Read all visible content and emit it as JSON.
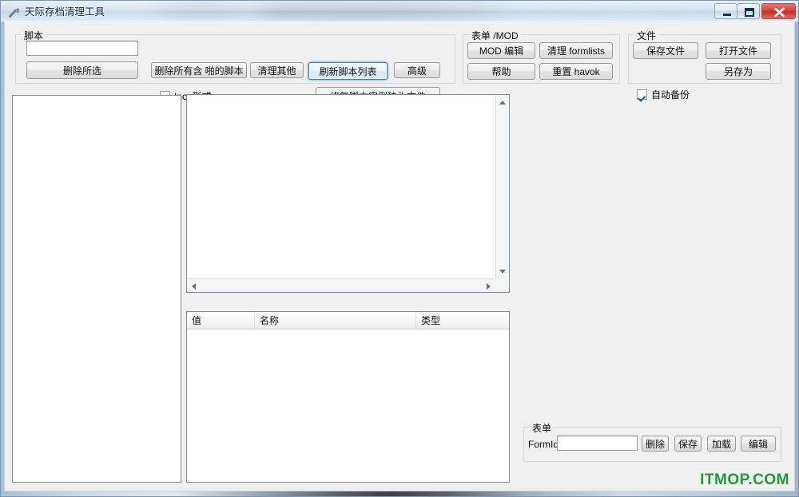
{
  "window": {
    "title": "天际存档清理工具",
    "icon": "wrench-icon",
    "controls": {
      "minimize": "minimize-icon",
      "maximize": "maximize-icon",
      "close": "close-icon"
    }
  },
  "script_group": {
    "legend": "脚本",
    "filter_value": "",
    "filter_placeholder": "",
    "delete_selected": "删除所选",
    "delete_all_containing": "删除所有含 啪的脚本",
    "clean_others": "清理其他",
    "refresh_list": "刷新脚本列表",
    "advanced": "高级",
    "inc_form_label": "Inc. 形式",
    "inc_form_checked": false,
    "repair_orphans": "修复脚本实例独头文件"
  },
  "form_mod_group": {
    "legend": "表单 /MOD",
    "mod_edit": "MOD 编辑",
    "clean_formlists": "清理 formlists",
    "help": "帮助",
    "reset_havok": "重置 havok"
  },
  "file_group": {
    "legend": "文件",
    "save_file": "保存文件",
    "open_file": "打开文件",
    "auto_backup_label": "自动备份",
    "auto_backup_checked": true,
    "save_as": "另存为"
  },
  "grid": {
    "columns": [
      "值",
      "名称",
      "类型"
    ],
    "rows": []
  },
  "form_group": {
    "legend": "表单",
    "formid_label": "FormId",
    "formid_value": "",
    "delete": "删除",
    "save": "保存",
    "load": "加载",
    "edit": "编辑"
  },
  "lists": {
    "left_items": [],
    "center_items": []
  },
  "watermark": "ITMOP.COM",
  "colors": {
    "accent_focus": "#3c7fb1",
    "watermark_green": "#1e9d31",
    "client_bg": "#f0f0f0",
    "close_red": "#c52e25"
  }
}
